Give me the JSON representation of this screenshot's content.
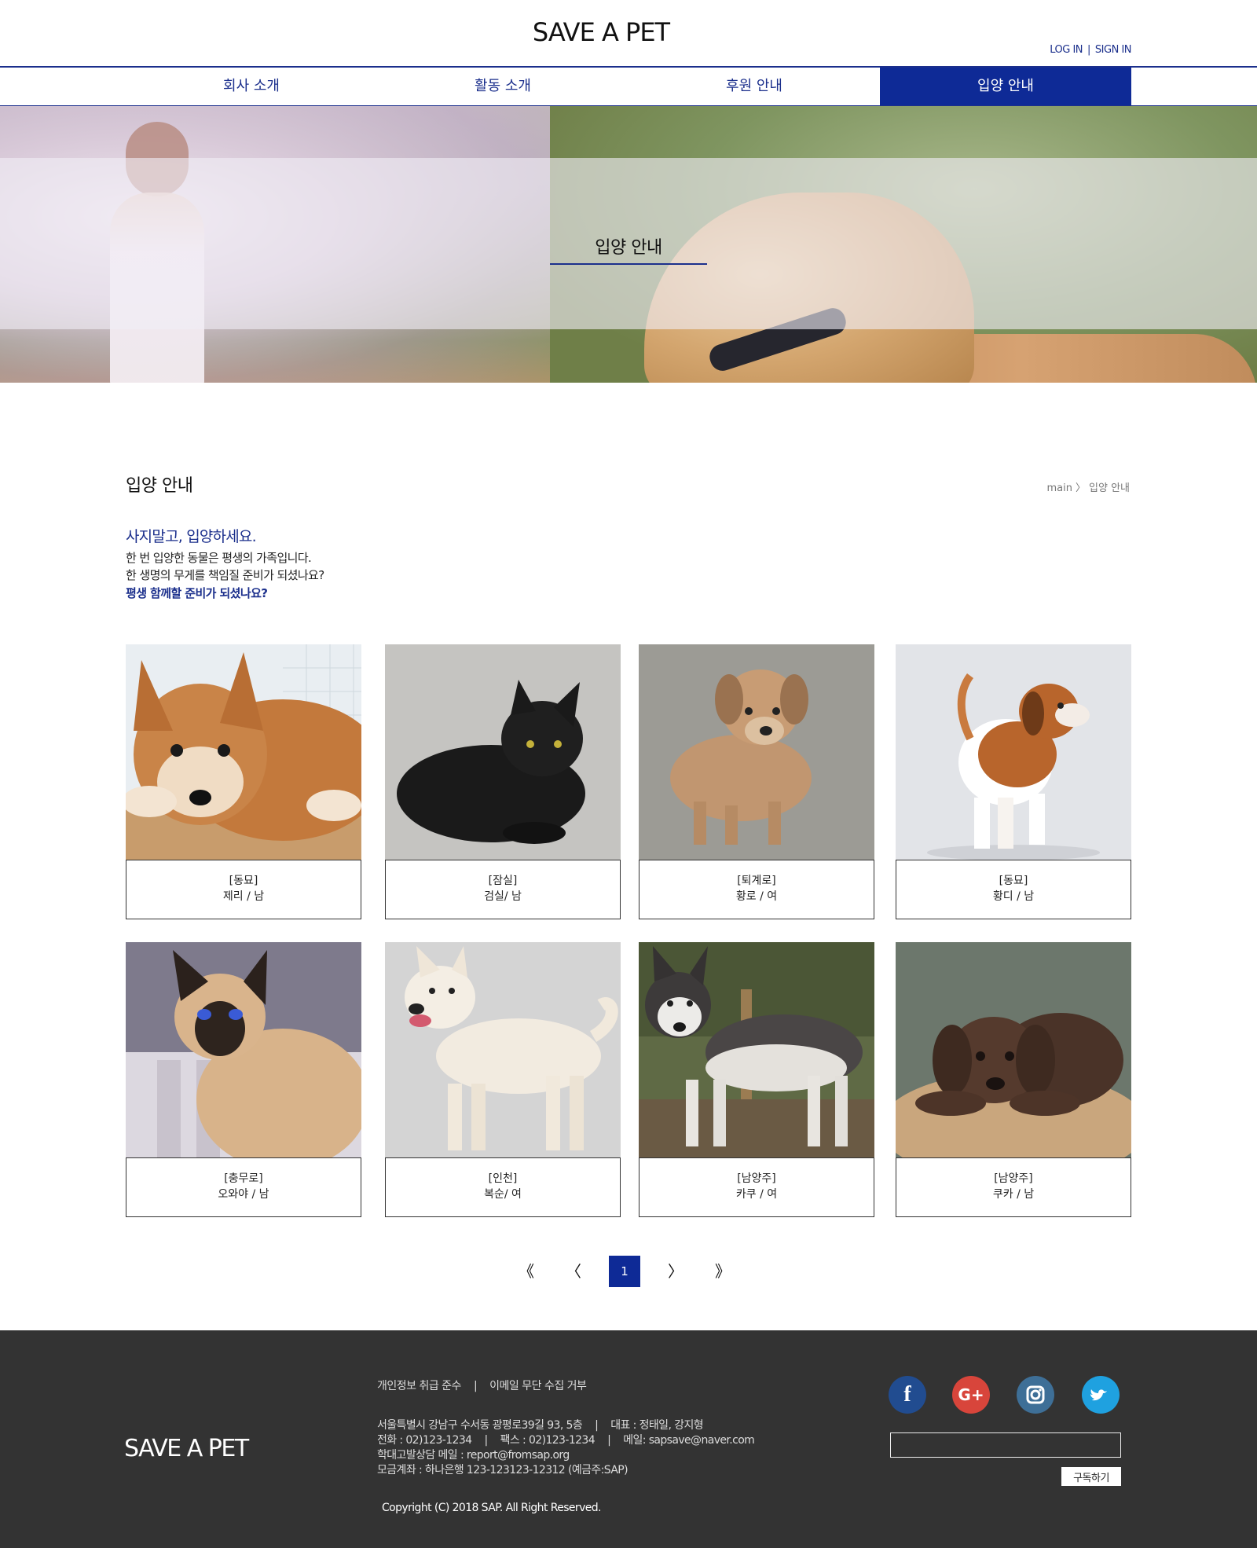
{
  "header": {
    "logo": "SAVE A PET",
    "login": "LOG IN",
    "separator": "|",
    "signin": "SIGN IN"
  },
  "nav": {
    "items": [
      {
        "label": "회사 소개"
      },
      {
        "label": "활동 소개"
      },
      {
        "label": "후원 안내"
      },
      {
        "label": "입양 안내",
        "active": true
      }
    ]
  },
  "hero": {
    "title": "입양 안내"
  },
  "page": {
    "title": "입양 안내",
    "breadcrumb": {
      "home": "main",
      "arrow": "〉",
      "current": "입양 안내"
    }
  },
  "intro": {
    "lead": "사지말고, 입양하세요.",
    "line1": "한 번 입양한 동물은 평생의 가족입니다.",
    "line2": "한 생명의 무게를 책임질 준비가 되셨나요?",
    "emphasis": "평생 함께할 준비가 되셨나요?"
  },
  "pets": [
    {
      "location": "[동묘]",
      "info": "제리 / 남",
      "photo": "shiba-puppy"
    },
    {
      "location": "[잠실]",
      "info": "검실/ 남",
      "photo": "black-cat"
    },
    {
      "location": "[퇴계로]",
      "info": "황로 / 여",
      "photo": "tan-puppy"
    },
    {
      "location": "[동묘]",
      "info": "황디 / 남",
      "photo": "beagle-puppy"
    },
    {
      "location": "[충무로]",
      "info": "오와야 / 남",
      "photo": "siamese-cat"
    },
    {
      "location": "[인천]",
      "info": "복순/ 여",
      "photo": "white-jindo"
    },
    {
      "location": "[남양주]",
      "info": "카쿠 / 여",
      "photo": "husky"
    },
    {
      "location": "[남양주]",
      "info": "쿠카 / 남",
      "photo": "chocolate-lab-puppy"
    }
  ],
  "pagination": {
    "first": "《",
    "prev": "〈",
    "current": "1",
    "next": "〉",
    "last": "》"
  },
  "footer": {
    "logo": "SAVE A PET",
    "links": [
      "개인정보 취급 준수",
      "이메일 무단 수집 거부"
    ],
    "separator": "|",
    "address": "서울특별시 강남구 수서동 광평로39길 93, 5층",
    "representative": "대표 : 정태일, 강지형",
    "phone": "전화 : 02)123-1234",
    "fax": "팩스 : 02)123-1234",
    "email": "메일: sapsave@naver.com",
    "report": "학대고발상담 메일 : report@fromsap.org",
    "account": "모금계좌 : 하나은행 123-123123-12312 (예금주:SAP)",
    "copyright": "Copyright (C) 2018 SAP. All Right Reserved.",
    "subscribe_value": "",
    "subscribe_button": "구독하기"
  },
  "social_icons": [
    "facebook-icon",
    "google-plus-icon",
    "instagram-icon",
    "twitter-icon"
  ],
  "colors": {
    "brand": "#0e2a96",
    "nav_text": "#1b2f8c",
    "footer_bg": "#333333",
    "facebook": "#214c90",
    "google_plus": "#d8453b",
    "instagram": "#3e6f97",
    "twitter": "#1fa1e0"
  }
}
